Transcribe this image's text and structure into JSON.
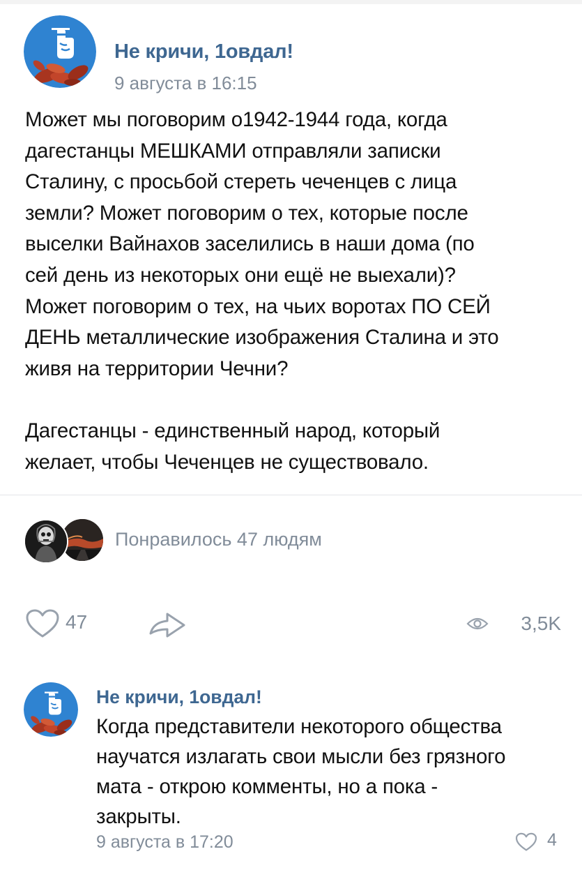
{
  "post": {
    "author": "Не кричи, 1овдал!",
    "date": "9 августа в 16:15",
    "text_lines_p1": [
      "Может мы поговорим о1942-1944 года, когда",
      "дагестанцы МЕШКАМИ отправляли записки",
      "Сталину, с просьбой стереть чеченцев с лица",
      "земли? Может поговорим о тех, которые после",
      "выселки Вайнахов заселились в наши дома (по",
      "сей день из некоторых они ещё не выехали)?",
      "Может поговорим о тех, на чьих воротах ПО СЕЙ",
      "ДЕНЬ металлические изображения Сталина и это",
      "живя на территории Чечни?"
    ],
    "text_lines_p2": [
      "Дагестанцы - единственный народ, который",
      "желает, чтобы Чеченцев не существовало."
    ]
  },
  "likes_summary": {
    "text": "Понравилось 47 людям"
  },
  "actions": {
    "like_count": "47",
    "views_count": "3,5K",
    "like_icon": "heart-outline-icon",
    "share_icon": "share-arrow-icon",
    "views_icon": "eye-icon"
  },
  "comment": {
    "author": "Не кричи, 1овдал!",
    "text_lines": [
      "Когда представители некоторого общества",
      "научатся излагать свои мысли без грязного",
      "мата - открою комменты, но а пока -",
      "закрыты."
    ],
    "date": "9 августа в 17:20",
    "like_count": "4"
  },
  "colors": {
    "link": "#3e6791",
    "secondary": "#818c99",
    "avatar_bg": "#2f83d1",
    "divider": "#e3e4e8"
  }
}
